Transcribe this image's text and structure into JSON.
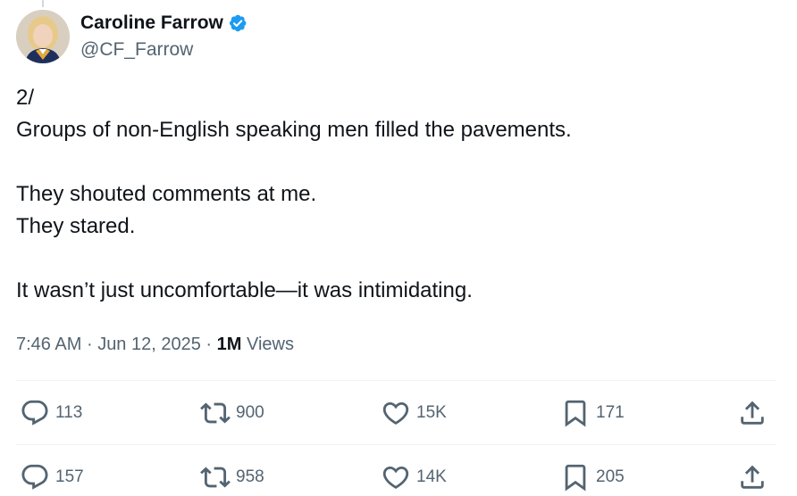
{
  "author": {
    "display_name": "Caroline Farrow",
    "handle": "@CF_Farrow",
    "verified": true,
    "verified_color": "#1d9bf0"
  },
  "tweet": {
    "lines": [
      "2/",
      "Groups of non-English speaking men filled the pavements.",
      "",
      "They shouted comments at me.",
      "They stared.",
      "",
      "It wasn’t just uncomfortable—it was intimidating."
    ],
    "time": "7:46 AM",
    "date": "Jun 12, 2025",
    "views_count": "1M",
    "views_label": "Views",
    "separator": "·"
  },
  "action_rows": [
    {
      "replies": "113",
      "reposts": "900",
      "likes": "15K",
      "bookmarks": "171"
    },
    {
      "replies": "157",
      "reposts": "958",
      "likes": "14K",
      "bookmarks": "205"
    }
  ],
  "icons": {
    "reply": "reply-icon",
    "repost": "repost-icon",
    "like": "heart-icon",
    "bookmark": "bookmark-icon",
    "share": "share-icon"
  },
  "colors": {
    "text": "#0f1419",
    "secondary": "#536471",
    "divider": "#eff3f4"
  }
}
